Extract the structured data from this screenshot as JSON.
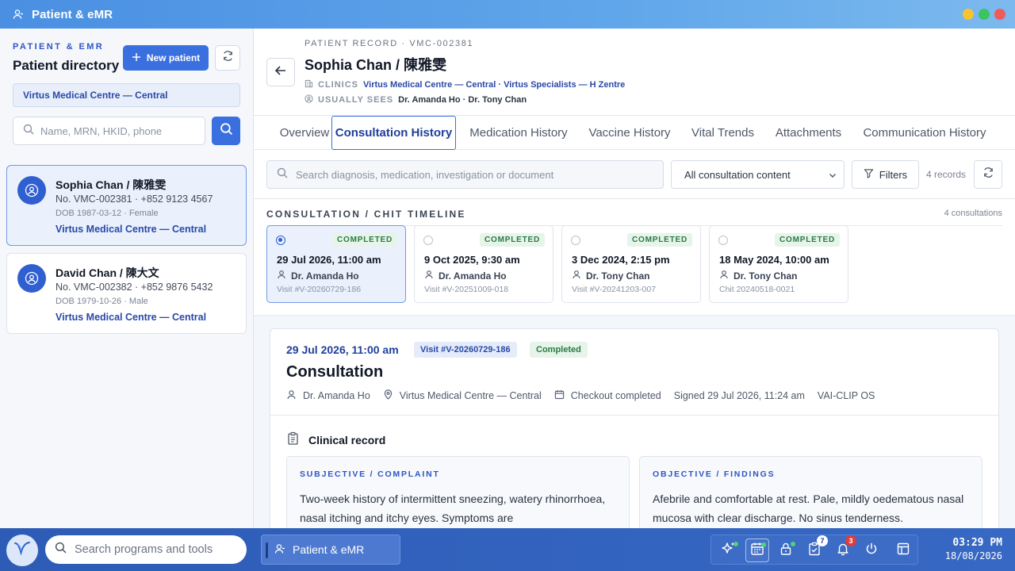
{
  "window": {
    "title": "Patient & eMR",
    "controls": {
      "minimize_color": "#f5c431",
      "maximize_color": "#3cc460",
      "close_color": "#ef5b5b"
    }
  },
  "sidebar": {
    "eyebrow": "PATIENT & EMR",
    "title": "Patient directory",
    "new_patient_label": "New patient",
    "clinic_filter": "Virtus Medical Centre — Central",
    "search_placeholder": "Name, MRN, HKID, phone",
    "patients": [
      {
        "name": "Sophia Chan / 陳雅雯",
        "meta": "No. VMC-002381 · +852 9123 4567",
        "dob": "DOB 1987-03-12 · Female",
        "clinic": "Virtus Medical Centre — Central",
        "selected": true
      },
      {
        "name": "David Chan / 陳大文",
        "meta": "No. VMC-002382 · +852 9876 5432",
        "dob": "DOB 1979-10-26 · Male",
        "clinic": "Virtus Medical Centre — Central",
        "selected": false
      }
    ]
  },
  "record": {
    "eyebrow": "PATIENT RECORD · VMC-002381",
    "name": "Sophia Chan / 陳雅雯",
    "clinics_label": "CLINICS",
    "clinics_value": "Virtus Medical Centre — Central · Virtus Specialists — H Zentre",
    "sees_label": "USUALLY SEES",
    "sees_value": "Dr. Amanda Ho · Dr. Tony Chan"
  },
  "tabs": [
    {
      "label": "Overview",
      "active": false
    },
    {
      "label": "Consultation History",
      "active": true
    },
    {
      "label": "Medication History",
      "active": false
    },
    {
      "label": "Vaccine History",
      "active": false
    },
    {
      "label": "Vital Trends",
      "active": false
    },
    {
      "label": "Attachments",
      "active": false
    },
    {
      "label": "Communication History",
      "active": false
    }
  ],
  "toolbar": {
    "search_placeholder": "Search diagnosis, medication, investigation or document",
    "content_filter": "All consultation content",
    "filters_label": "Filters",
    "record_count": "4 records"
  },
  "timeline": {
    "label": "CONSULTATION / CHIT TIMELINE",
    "count": "4 consultations",
    "items": [
      {
        "status": "COMPLETED",
        "date": "29 Jul 2026, 11:00 am",
        "doctor": "Dr. Amanda Ho",
        "ref": "Visit #V-20260729-186",
        "active": true
      },
      {
        "status": "COMPLETED",
        "date": "9 Oct 2025, 9:30 am",
        "doctor": "Dr. Amanda Ho",
        "ref": "Visit #V-20251009-018",
        "active": false
      },
      {
        "status": "COMPLETED",
        "date": "3 Dec 2024, 2:15 pm",
        "doctor": "Dr. Tony Chan",
        "ref": "Visit #V-20241203-007",
        "active": false
      },
      {
        "status": "COMPLETED",
        "date": "18 May 2024, 10:00 am",
        "doctor": "Dr. Tony Chan",
        "ref": "Chit 20240518-0021",
        "active": false
      }
    ]
  },
  "detail": {
    "date": "29 Jul 2026, 11:00 am",
    "visit_ref": "Visit #V-20260729-186",
    "status": "Completed",
    "title": "Consultation",
    "doctor": "Dr. Amanda Ho",
    "clinic": "Virtus Medical Centre — Central",
    "checkout": "Checkout completed",
    "signed": "Signed 29 Jul 2026, 11:24 am",
    "system": "VAI-CLIP OS",
    "clinical_record_title": "Clinical record",
    "subjective_heading": "SUBJECTIVE / COMPLAINT",
    "subjective_text": "Two-week history of intermittent sneezing, watery rhinorrhoea, nasal itching and itchy eyes. Symptoms are",
    "objective_heading": "OBJECTIVE / FINDINGS",
    "objective_text": "Afebrile and comfortable at rest. Pale, mildly oedematous nasal mucosa with clear discharge. No sinus tenderness."
  },
  "taskbar": {
    "search_placeholder": "Search programs and tools",
    "active_app": "Patient & eMR",
    "tray": [
      {
        "icon": "sparkle-icon",
        "badge": "",
        "dot": true
      },
      {
        "icon": "calendar-icon",
        "badge": "",
        "dot": true,
        "selected": true
      },
      {
        "icon": "lock-icon",
        "badge": "",
        "dot": true
      },
      {
        "icon": "clipboard-check-icon",
        "badge": "7",
        "dot": false
      },
      {
        "icon": "bell-icon",
        "badge": "3",
        "dot": false
      },
      {
        "icon": "power-icon",
        "badge": "",
        "dot": false
      },
      {
        "icon": "layout-icon",
        "badge": "",
        "dot": false
      }
    ],
    "time": "03:29 PM",
    "date": "18/08/2026"
  }
}
